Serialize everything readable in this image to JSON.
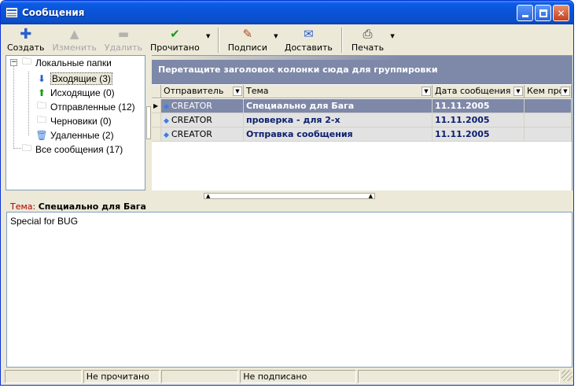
{
  "window": {
    "title": "Сообщения"
  },
  "toolbar": {
    "create": "Создать",
    "edit": "Изменить",
    "delete": "Удалить",
    "read": "Прочитано",
    "sign": "Подписи",
    "send": "Доставить",
    "print": "Печать"
  },
  "tree": {
    "root": "Локальные папки",
    "items": [
      "Входящие (3)",
      "Исходящие (0)",
      "Отправленные (12)",
      "Черновики (0)",
      "Удаленные (2)"
    ],
    "all": "Все сообщения (17)"
  },
  "grid": {
    "group_hint": "Перетащите заголовок колонки сюда для группировки",
    "columns": [
      "Отправитель",
      "Тема",
      "Дата сообщения",
      "Кем про"
    ],
    "rows": [
      {
        "sender": "CREATOR",
        "subject": "Специально для Бага",
        "date": "11.11.2005",
        "by": ""
      },
      {
        "sender": "CREATOR",
        "subject": "проверка - для 2-х",
        "date": "11.11.2005",
        "by": ""
      },
      {
        "sender": "CREATOR",
        "subject": "Отправка сообщения",
        "date": "11.11.2005",
        "by": ""
      }
    ]
  },
  "preview": {
    "subject_label": "Тема:",
    "subject": "Специально для Бага",
    "body": "Special for BUG"
  },
  "status": {
    "read": "Не прочитано",
    "signed": "Не подписано"
  }
}
